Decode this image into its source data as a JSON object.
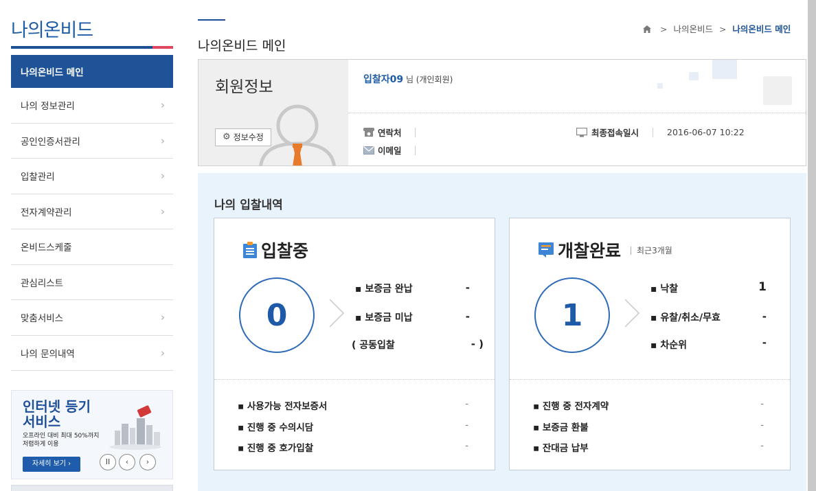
{
  "sidebar": {
    "title": "나의온비드",
    "items": [
      {
        "label": "나의온비드 메인",
        "active": true,
        "chevron": false
      },
      {
        "label": "나의 정보관리",
        "chevron": true
      },
      {
        "label": "공인인증서관리",
        "chevron": true
      },
      {
        "label": "입찰관리",
        "chevron": true
      },
      {
        "label": "전자계약관리",
        "chevron": true
      },
      {
        "label": "온비드스케줄",
        "chevron": false
      },
      {
        "label": "관심리스트",
        "chevron": false
      },
      {
        "label": "맞춤서비스",
        "chevron": true
      },
      {
        "label": "나의 문의내역",
        "chevron": true
      }
    ],
    "chevron_glyph": "›",
    "banner": {
      "title_line1": "인터넷 등기",
      "title_line2": "서비스",
      "sub_line1": "오프라인 대비 최대 50%까지",
      "sub_line2": "저렴하게 이용",
      "button": "자세히 보기 ›",
      "pause": "II",
      "prev": "‹",
      "next": "›"
    }
  },
  "header": {
    "title": "나의온비드 메인",
    "breadcrumb": {
      "home_icon": "home-icon",
      "sep": ">",
      "parent": "나의온비드",
      "current": "나의온비드 메인"
    }
  },
  "member": {
    "heading": "회원정보",
    "edit_button": "정보수정",
    "name": "입찰자09",
    "name_suffix": " 님 (개인회원)",
    "contact_label": "연락처",
    "email_label": "이메일",
    "last_login_label": "최종접속일시",
    "last_login_value": "2016-06-07 10:22"
  },
  "bids": {
    "title": "나의 입찰내역",
    "bidding": {
      "title": "입찰중",
      "count": "0",
      "stats": [
        {
          "label": "▪ 보증금 완납",
          "value": "-"
        },
        {
          "label": "▪ 보증금 미납",
          "value": "-"
        },
        {
          "label": "(   공동입찰",
          "value": "- )"
        }
      ],
      "bottom": [
        {
          "label": "▪ 사용가능 전자보증서",
          "value": "-"
        },
        {
          "label": "▪ 진행 중 수의시담",
          "value": "-"
        },
        {
          "label": "▪ 진행 중 호가입찰",
          "value": "-"
        }
      ]
    },
    "opened": {
      "title": "개찰완료",
      "subtitle": "최근3개월",
      "count": "1",
      "stats": [
        {
          "label": "▪ 낙찰",
          "value": "1"
        },
        {
          "label": "▪ 유찰/취소/무효",
          "value": "-"
        },
        {
          "label": "▪ 차순위",
          "value": "-"
        }
      ],
      "bottom": [
        {
          "label": "▪ 진행 중 전자계약",
          "value": "-"
        },
        {
          "label": "▪ 보증금 환불",
          "value": "-"
        },
        {
          "label": "▪ 잔대금 납부",
          "value": "-"
        }
      ]
    }
  },
  "colors": {
    "brand": "#1f5397",
    "accent_red": "#e0475f",
    "panel_bg": "#e9f3fc"
  }
}
